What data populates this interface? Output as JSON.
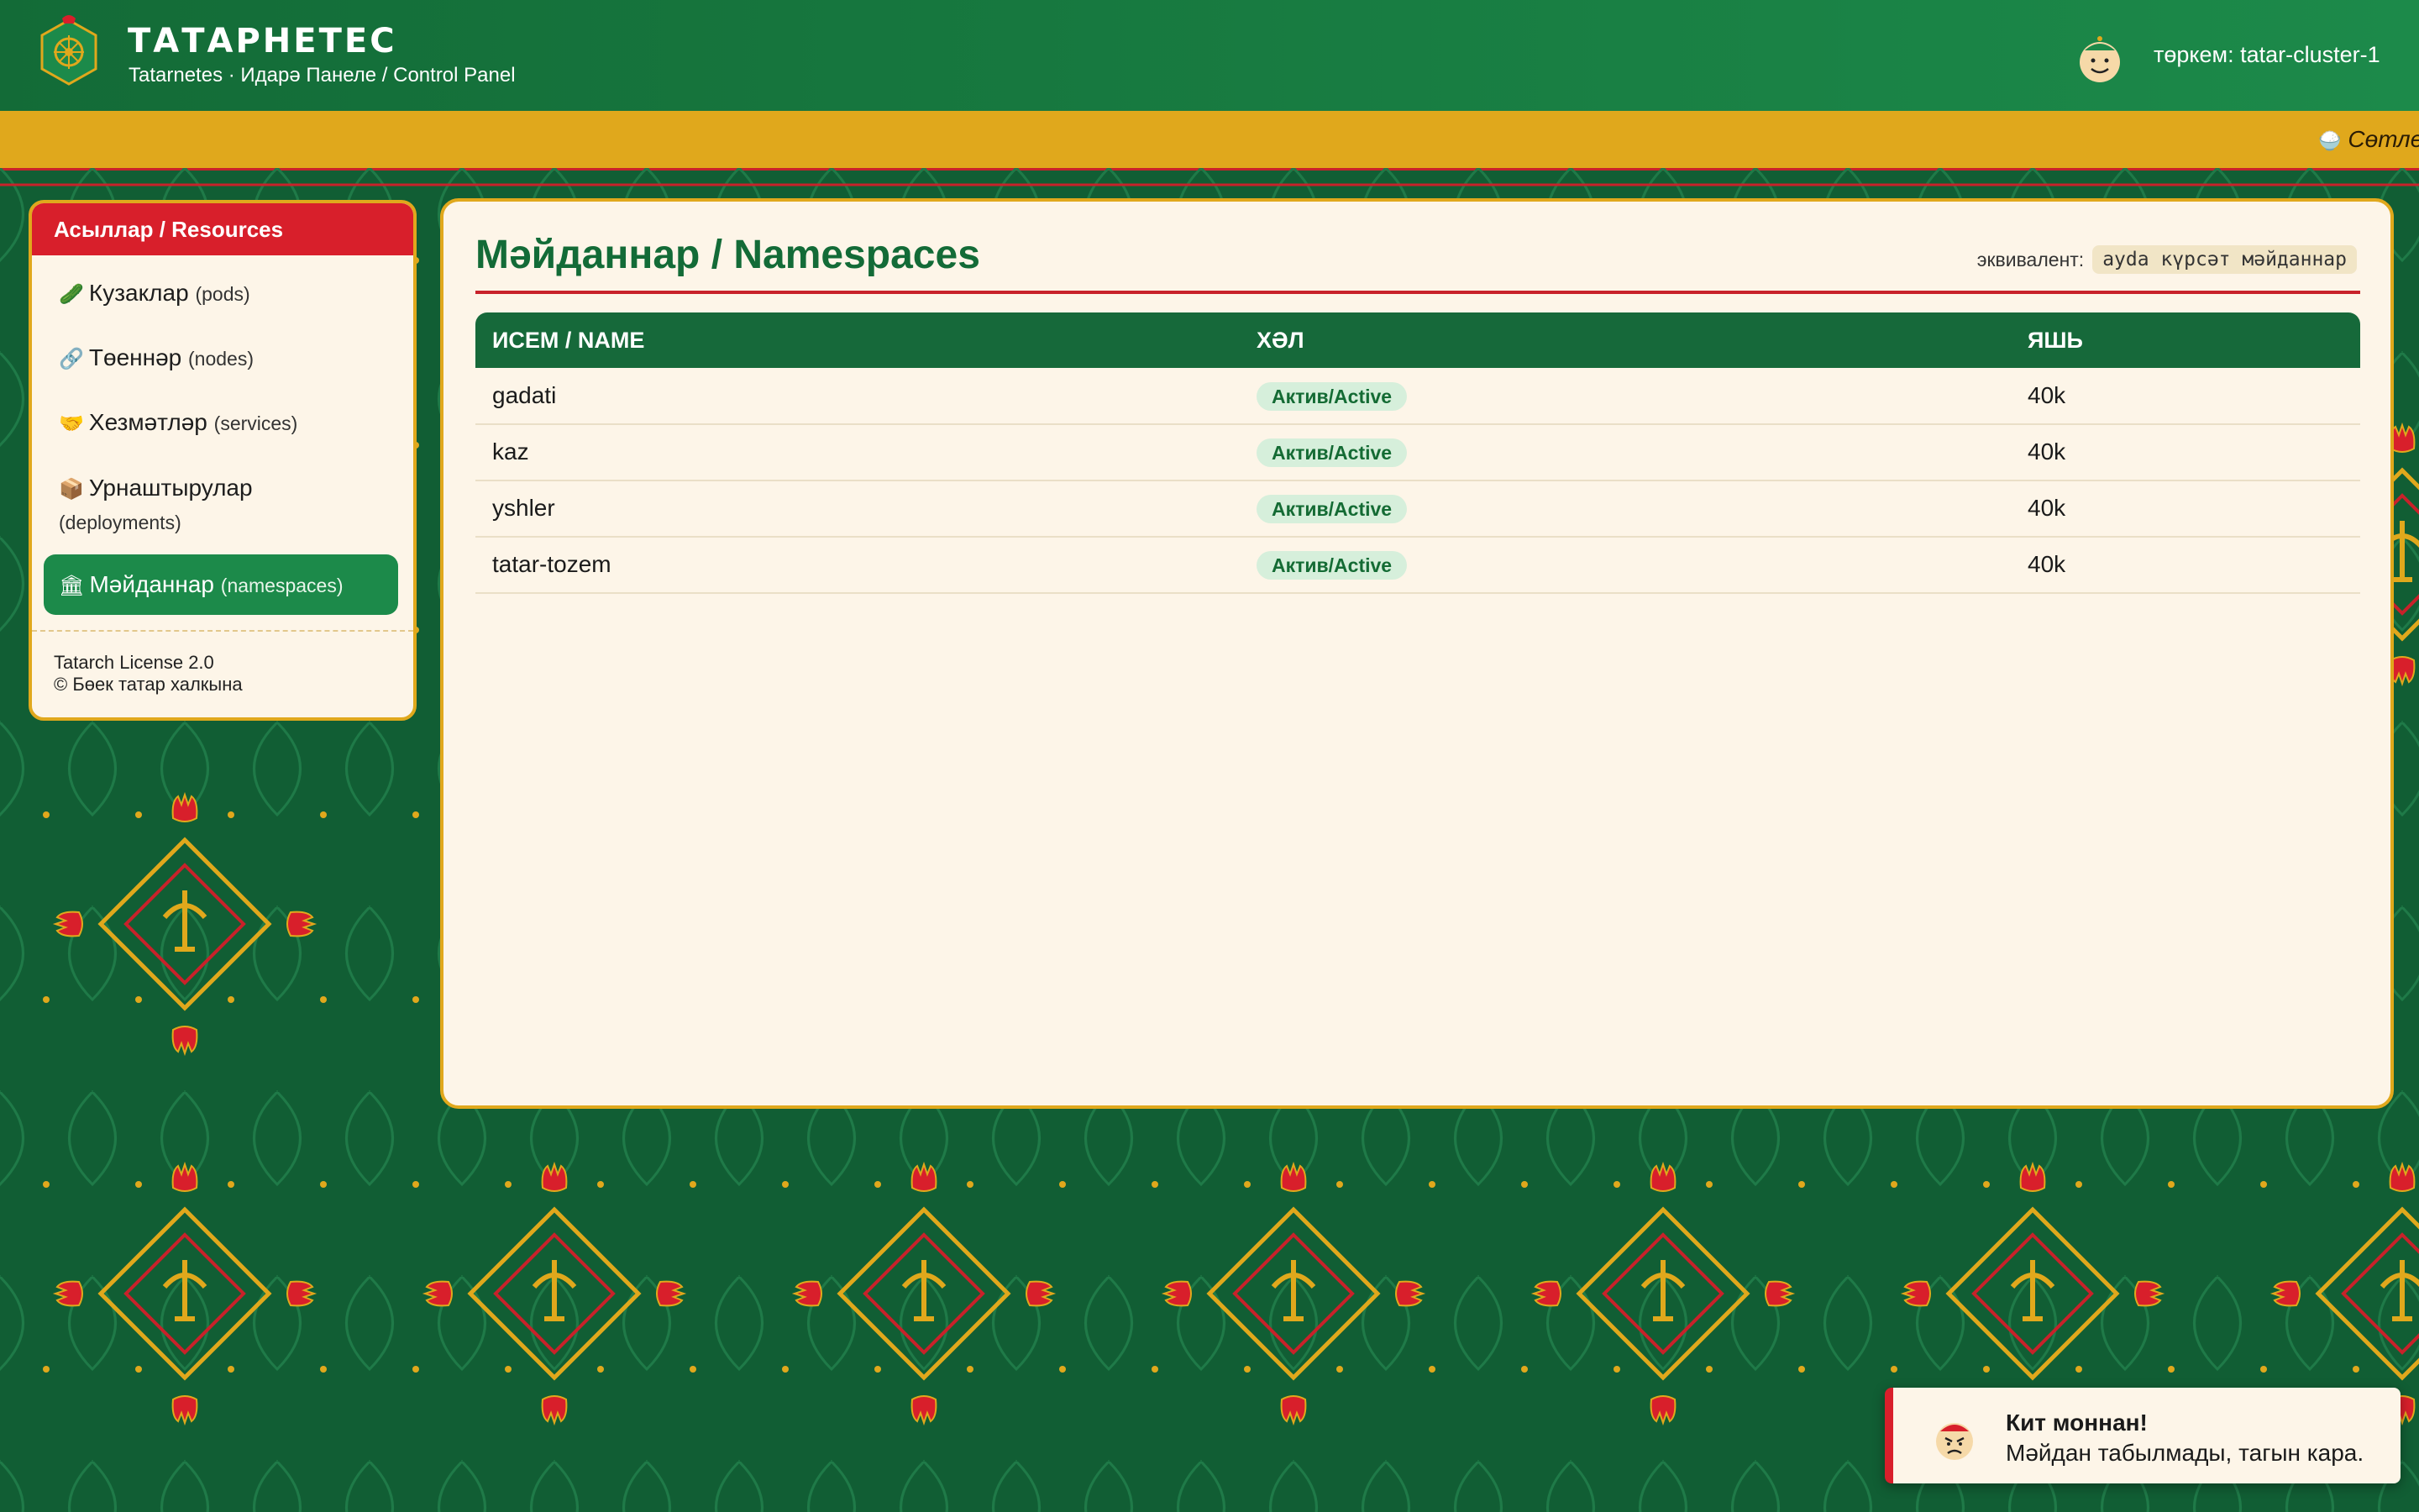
{
  "header": {
    "title": "ТАТАРНЕТЕС",
    "subtitle": "Tatarnetes · Идарә Панеле / Control Panel",
    "cluster_label": "төркем: tatar-cluster-1",
    "logo_icon": "tatarnetes-logo-icon",
    "avatar_icon": "smiling-face-avatar-icon"
  },
  "ticker": {
    "text": "Сөтле",
    "icon": "bowl-icon"
  },
  "sidebar": {
    "title": "Асыллар / Resources",
    "items": [
      {
        "icon": "🥒",
        "icon_name": "cucumber-icon",
        "label": "Кузаклар",
        "en": "(pods)"
      },
      {
        "icon": "🔗",
        "icon_name": "link-icon",
        "label": "Төеннәр",
        "en": "(nodes)"
      },
      {
        "icon": "🤝",
        "icon_name": "handshake-icon",
        "label": "Хезмәтләр",
        "en": "(services)"
      },
      {
        "icon": "📦",
        "icon_name": "package-icon",
        "label": "Урнаштырулар",
        "en": "(deployments)"
      },
      {
        "icon": "🏛",
        "icon_name": "building-icon",
        "label": "Мәйданнар",
        "en": "(namespaces)",
        "active": true
      }
    ],
    "footer_license": "Tatarch License 2.0",
    "footer_copyright": "© Бөек татар халкына"
  },
  "main": {
    "title": "Мәйданнар / Namespaces",
    "equivalent_label": "эквивалент:",
    "equivalent_command": "ayda күрсәт мәйданнар",
    "columns": [
      "ИСЕМ / NAME",
      "ХӘЛ",
      "ЯШЬ"
    ],
    "rows": [
      {
        "name": "gadati",
        "status": "Актив/Active",
        "age": "40k"
      },
      {
        "name": "kaz",
        "status": "Актив/Active",
        "age": "40k"
      },
      {
        "name": "yshler",
        "status": "Актив/Active",
        "age": "40k"
      },
      {
        "name": "tatar-tozem",
        "status": "Актив/Active",
        "age": "40k"
      }
    ]
  },
  "toast": {
    "title": "Кит моннан!",
    "message": "Мәйдан табылмады, тагын кара.",
    "icon": "angry-face-icon"
  },
  "colors": {
    "header_green": "#136b37",
    "accent_gold": "#e0a81c",
    "accent_red": "#d81f2b",
    "background_green": "#115e34",
    "panel_cream": "#fdf5e8"
  }
}
